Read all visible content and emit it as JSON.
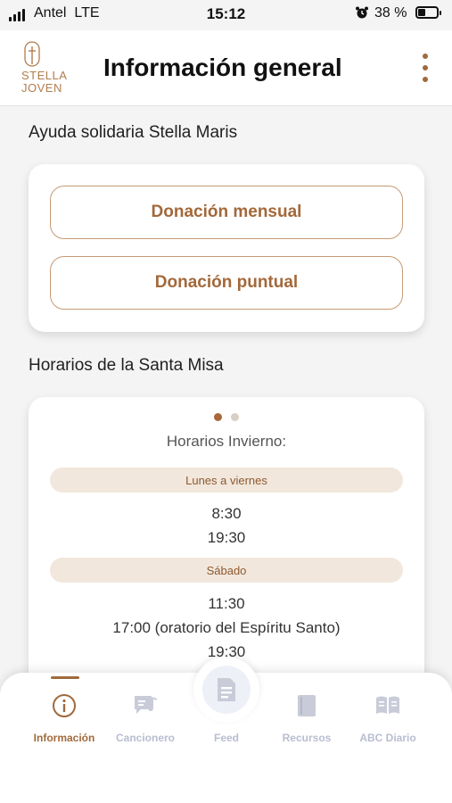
{
  "status_bar": {
    "carrier": "Antel",
    "network": "LTE",
    "time": "15:12",
    "battery": "38 %",
    "battery_level": 0.38
  },
  "header": {
    "logo_line1": "STELLA",
    "logo_line2": "JOVEN",
    "title": "Información general"
  },
  "donations": {
    "section_title": "Ayuda solidaria Stella Maris",
    "monthly_label": "Donación mensual",
    "single_label": "Donación puntual"
  },
  "mass": {
    "section_title": "Horarios de la Santa Misa",
    "schedule_title": "Horarios Invierno:",
    "pages": 2,
    "current_page": 1,
    "groups": [
      {
        "day": "Lunes a viernes",
        "times": [
          "8:30",
          "19:30"
        ]
      },
      {
        "day": "Sábado",
        "times": [
          "11:30",
          "17:00 (oratorio del Espíritu Santo)",
          "19:30"
        ]
      }
    ]
  },
  "bottom_nav": {
    "items": [
      {
        "label": "Información",
        "icon": "info-icon",
        "active": true
      },
      {
        "label": "Cancionero",
        "icon": "music-note-icon",
        "active": false
      },
      {
        "label": "Feed",
        "icon": "feed-icon",
        "active": false
      },
      {
        "label": "Recursos",
        "icon": "book-icon",
        "active": false
      },
      {
        "label": "ABC Diario",
        "icon": "open-book-icon",
        "active": false
      }
    ]
  },
  "colors": {
    "accent": "#a06a3c",
    "pill_background": "#f2e7dc",
    "inactive_nav": "#b8bdd0"
  }
}
